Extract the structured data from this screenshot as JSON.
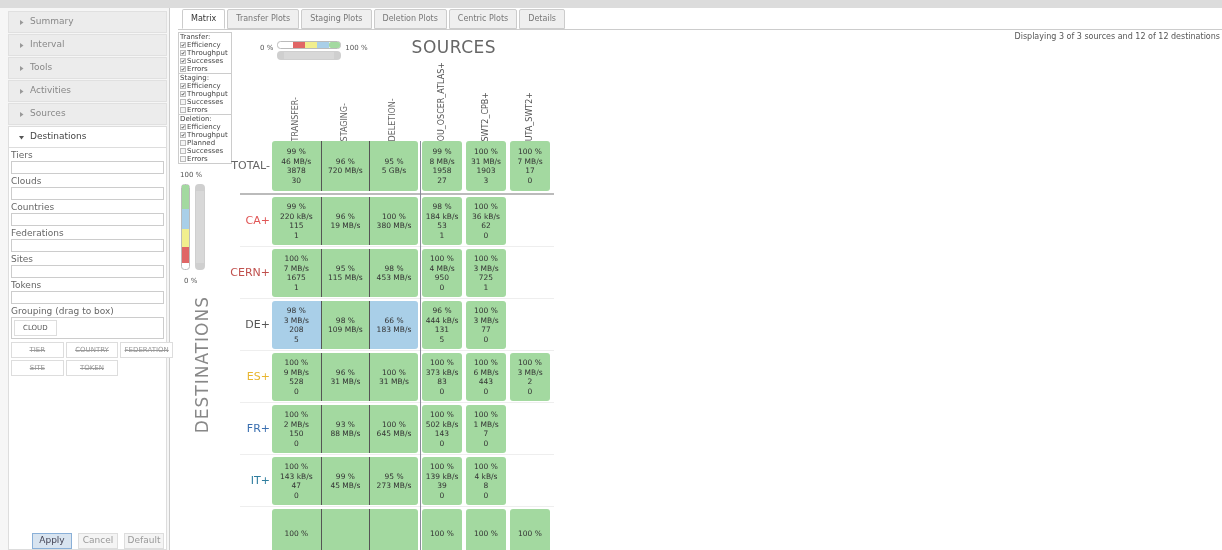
{
  "sidebar": {
    "sections": [
      {
        "label": "Summary",
        "expanded": false
      },
      {
        "label": "Interval",
        "expanded": false
      },
      {
        "label": "Tools",
        "expanded": false
      },
      {
        "label": "Activities",
        "expanded": false
      },
      {
        "label": "Sources",
        "expanded": false
      },
      {
        "label": "Destinations",
        "expanded": true
      }
    ],
    "fields": [
      "Tiers",
      "Clouds",
      "Countries",
      "Federations",
      "Sites",
      "Tokens"
    ],
    "grouping": {
      "label": "Grouping (drag to box)",
      "in_box": [
        "CLOUD"
      ],
      "available": [
        {
          "label": "TIER",
          "disabled": true
        },
        {
          "label": "COUNTRY",
          "disabled": true
        },
        {
          "label": "FEDERATION",
          "disabled": true
        },
        {
          "label": "SITE",
          "disabled": true
        },
        {
          "label": "TOKEN",
          "disabled": true
        }
      ]
    },
    "buttons": [
      {
        "label": "Apply",
        "focused": true
      },
      {
        "label": "Cancel",
        "focused": false
      },
      {
        "label": "Default",
        "focused": false
      }
    ]
  },
  "tabs": [
    {
      "label": "Matrix",
      "selected": true
    },
    {
      "label": "Transfer Plots",
      "selected": false
    },
    {
      "label": "Staging Plots",
      "selected": false
    },
    {
      "label": "Deletion Plots",
      "selected": false
    },
    {
      "label": "Centric Plots",
      "selected": false
    },
    {
      "label": "Details",
      "selected": false
    }
  ],
  "summary": "Displaying 3 of 3 sources and 12 of 12 destinations",
  "options": [
    {
      "title": "Transfer:",
      "items": [
        {
          "label": "Efficiency",
          "checked": true
        },
        {
          "label": "Throughput",
          "checked": true
        },
        {
          "label": "Successes",
          "checked": true
        },
        {
          "label": "Errors",
          "checked": true
        }
      ]
    },
    {
      "title": "Staging:",
      "items": [
        {
          "label": "Efficiency",
          "checked": true
        },
        {
          "label": "Throughput",
          "checked": true
        },
        {
          "label": "Successes",
          "checked": false
        },
        {
          "label": "Errors",
          "checked": false
        }
      ]
    },
    {
      "title": "Deletion:",
      "items": [
        {
          "label": "Efficiency",
          "checked": true
        },
        {
          "label": "Throughput",
          "checked": true
        },
        {
          "label": "Planned",
          "checked": false
        },
        {
          "label": "Successes",
          "checked": false
        },
        {
          "label": "Errors",
          "checked": false
        }
      ]
    }
  ],
  "horizontal_scale": {
    "min_label": "0 %",
    "max_label": "100 %"
  },
  "vertical_scale": {
    "max_label": "100 %",
    "min_label": "0 %"
  },
  "sources_title": "SOURCES",
  "destinations_title": "DESTINATIONS",
  "group_columns": [
    "TRANSFER-",
    "STAGING-",
    "DELETION-"
  ],
  "source_columns": [
    "OU_OSCER_ATLAS+",
    "SWT2_CPB+",
    "UTA_SWT2+"
  ],
  "rows": [
    {
      "label": "TOTAL-",
      "color": "#666666",
      "group_cells": [
        {
          "lines": [
            "99 %",
            "46 MB/s",
            "3878",
            "30"
          ],
          "color": "#a3d9a0"
        },
        {
          "lines": [
            "96 %",
            "720 MB/s"
          ],
          "color": "#a3d9a0"
        },
        {
          "lines": [
            "95 %",
            "5 GB/s"
          ],
          "color": "#a3d9a0"
        }
      ],
      "source_cells": [
        {
          "lines": [
            "99 %",
            "8 MB/s",
            "1958",
            "27"
          ],
          "color": "#a3d9a0"
        },
        {
          "lines": [
            "100 %",
            "31 MB/s",
            "1903",
            "3"
          ],
          "color": "#a3d9a0"
        },
        {
          "lines": [
            "100 %",
            "7 MB/s",
            "17",
            "0"
          ],
          "color": "#a3d9a0"
        }
      ]
    },
    {
      "label": "CA+",
      "color": "#e05555",
      "group_cells": [
        {
          "lines": [
            "99 %",
            "220 kB/s",
            "115",
            "1"
          ],
          "color": "#a3d9a0"
        },
        {
          "lines": [
            "96 %",
            "19 MB/s"
          ],
          "color": "#a3d9a0"
        },
        {
          "lines": [
            "100 %",
            "380 MB/s"
          ],
          "color": "#a3d9a0"
        }
      ],
      "source_cells": [
        {
          "lines": [
            "98 %",
            "184 kB/s",
            "53",
            "1"
          ],
          "color": "#a3d9a0"
        },
        {
          "lines": [
            "100 %",
            "36 kB/s",
            "62",
            "0"
          ],
          "color": "#a3d9a0"
        }
      ]
    },
    {
      "label": "CERN+",
      "color": "#c0504d",
      "group_cells": [
        {
          "lines": [
            "100 %",
            "7 MB/s",
            "1675",
            "1"
          ],
          "color": "#a3d9a0"
        },
        {
          "lines": [
            "95 %",
            "115 MB/s"
          ],
          "color": "#a3d9a0"
        },
        {
          "lines": [
            "98 %",
            "453 MB/s"
          ],
          "color": "#a3d9a0"
        }
      ],
      "source_cells": [
        {
          "lines": [
            "100 %",
            "4 MB/s",
            "950",
            "0"
          ],
          "color": "#a3d9a0"
        },
        {
          "lines": [
            "100 %",
            "3 MB/s",
            "725",
            "1"
          ],
          "color": "#a3d9a0"
        }
      ]
    },
    {
      "label": "DE+",
      "color": "#555555",
      "group_cells": [
        {
          "lines": [
            "98 %",
            "3 MB/s",
            "208",
            "5"
          ],
          "color": "#a9cfe8"
        },
        {
          "lines": [
            "98 %",
            "109 MB/s"
          ],
          "color": "#a3d9a0"
        },
        {
          "lines": [
            "66 %",
            "183 MB/s"
          ],
          "color": "#a9cfe8"
        }
      ],
      "source_cells": [
        {
          "lines": [
            "96 %",
            "444 kB/s",
            "131",
            "5"
          ],
          "color": "#a3d9a0"
        },
        {
          "lines": [
            "100 %",
            "3 MB/s",
            "77",
            "0"
          ],
          "color": "#a3d9a0"
        }
      ]
    },
    {
      "label": "ES+",
      "color": "#e8b630",
      "group_cells": [
        {
          "lines": [
            "100 %",
            "9 MB/s",
            "528",
            "0"
          ],
          "color": "#a3d9a0"
        },
        {
          "lines": [
            "96 %",
            "31 MB/s"
          ],
          "color": "#a3d9a0"
        },
        {
          "lines": [
            "100 %",
            "31 MB/s"
          ],
          "color": "#a3d9a0"
        }
      ],
      "source_cells": [
        {
          "lines": [
            "100 %",
            "373 kB/s",
            "83",
            "0"
          ],
          "color": "#a3d9a0"
        },
        {
          "lines": [
            "100 %",
            "6 MB/s",
            "443",
            "0"
          ],
          "color": "#a3d9a0"
        },
        {
          "lines": [
            "100 %",
            "3 MB/s",
            "2",
            "0"
          ],
          "color": "#a3d9a0"
        }
      ]
    },
    {
      "label": "FR+",
      "color": "#3a6fb0",
      "group_cells": [
        {
          "lines": [
            "100 %",
            "2 MB/s",
            "150",
            "0"
          ],
          "color": "#a3d9a0"
        },
        {
          "lines": [
            "93 %",
            "88 MB/s"
          ],
          "color": "#a3d9a0"
        },
        {
          "lines": [
            "100 %",
            "645 MB/s"
          ],
          "color": "#a3d9a0"
        }
      ],
      "source_cells": [
        {
          "lines": [
            "100 %",
            "502 kB/s",
            "143",
            "0"
          ],
          "color": "#a3d9a0"
        },
        {
          "lines": [
            "100 %",
            "1 MB/s",
            "7",
            "0"
          ],
          "color": "#a3d9a0"
        }
      ]
    },
    {
      "label": "IT+",
      "color": "#2f7d9e",
      "group_cells": [
        {
          "lines": [
            "100 %",
            "143 kB/s",
            "47",
            "0"
          ],
          "color": "#a3d9a0"
        },
        {
          "lines": [
            "99 %",
            "45 MB/s"
          ],
          "color": "#a3d9a0"
        },
        {
          "lines": [
            "95 %",
            "273 MB/s"
          ],
          "color": "#a3d9a0"
        }
      ],
      "source_cells": [
        {
          "lines": [
            "100 %",
            "139 kB/s",
            "39",
            "0"
          ],
          "color": "#a3d9a0"
        },
        {
          "lines": [
            "100 %",
            "4 kB/s",
            "8",
            "0"
          ],
          "color": "#a3d9a0"
        }
      ]
    },
    {
      "group_cells": [
        {
          "lines": [
            "100 %"
          ],
          "color": "#a3d9a0"
        },
        {
          "color": "#a3d9a0"
        },
        {
          "color": "#a3d9a0"
        }
      ],
      "source_cells": [
        {
          "lines": [
            "100 %"
          ],
          "color": "#a3d9a0"
        },
        {
          "lines": [
            "100 %"
          ],
          "color": "#a3d9a0"
        },
        {
          "lines": [
            "100 %"
          ],
          "color": "#a3d9a0"
        }
      ]
    }
  ]
}
